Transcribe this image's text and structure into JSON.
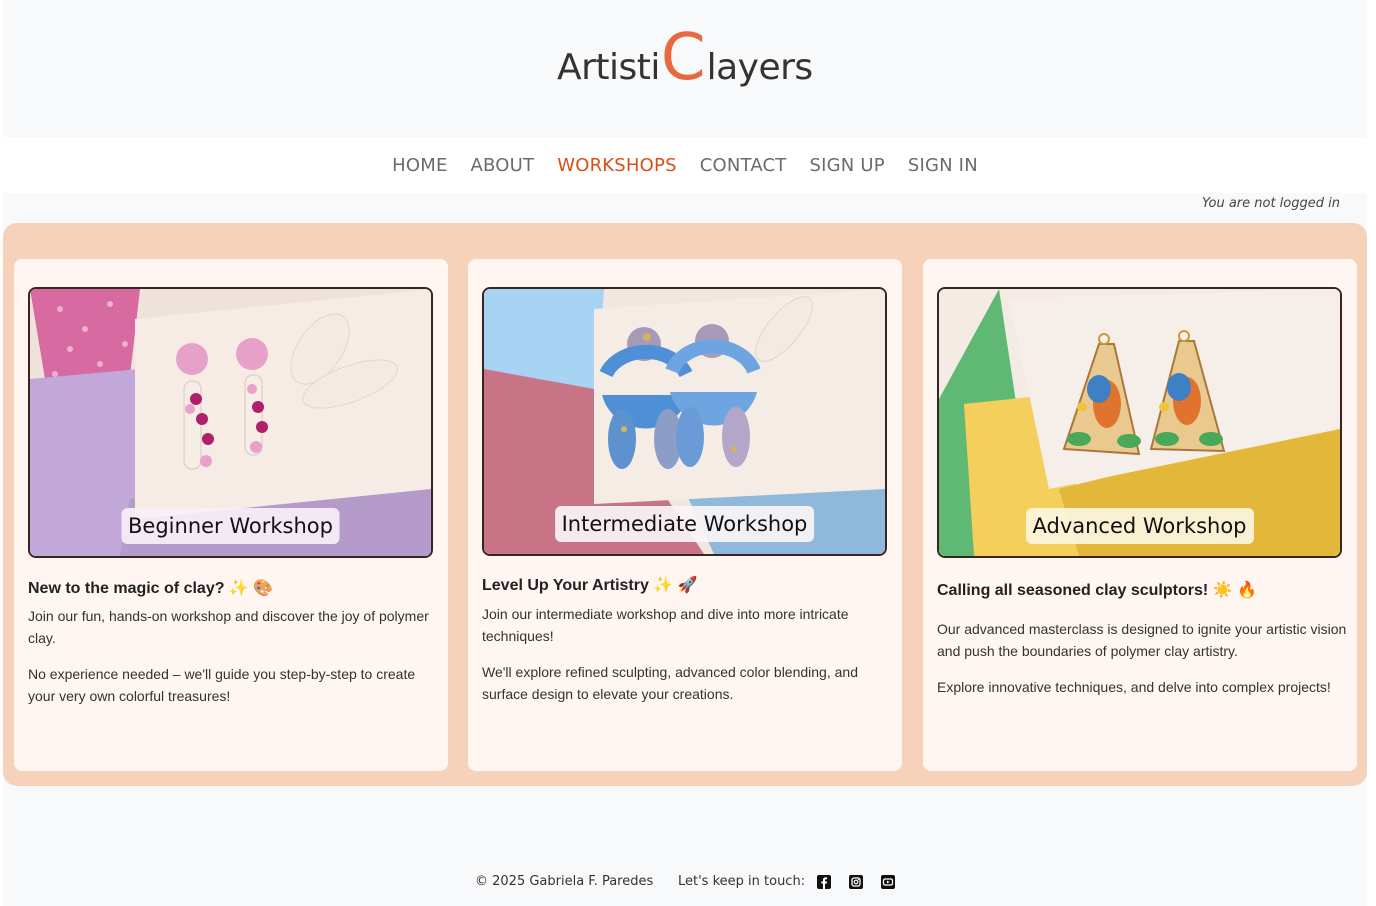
{
  "logo": {
    "part1": "Artisti",
    "accent": "C",
    "part2": "layers",
    "accent_color": "#e8693e"
  },
  "nav": {
    "items": [
      {
        "label": "HOME",
        "active": false
      },
      {
        "label": "ABOUT",
        "active": false
      },
      {
        "label": "WORKSHOPS",
        "active": true
      },
      {
        "label": "CONTACT",
        "active": false
      },
      {
        "label": "SIGN UP",
        "active": false
      },
      {
        "label": "SIGN IN",
        "active": false
      }
    ]
  },
  "login_status": "You are not logged in",
  "workshops": [
    {
      "label": "Beginner Workshop",
      "title": "New to the magic of clay? ✨ 🎨",
      "paragraphs": [
        "Join our fun, hands-on workshop and discover the joy of polymer clay.",
        "No experience needed – we'll guide you step-by-step to create your very own colorful treasures!"
      ]
    },
    {
      "label": "Intermediate Workshop",
      "title": "Level Up Your Artistry ✨ 🚀",
      "paragraphs": [
        "Join our intermediate workshop and dive into more intricate techniques!",
        "We'll explore refined sculpting, advanced color blending, and surface design to elevate your creations."
      ]
    },
    {
      "label": "Advanced Workshop",
      "title": "Calling all seasoned clay sculptors! ☀️ 🔥",
      "paragraphs": [
        "Our advanced masterclass is designed to ignite your artistic vision and push the boundaries of polymer clay artistry.",
        "Explore innovative techniques, and delve into complex projects!"
      ]
    }
  ],
  "footer": {
    "copyright": "© 2025 Gabriela F. Paredes",
    "keep_in_touch": "Let's keep in touch:",
    "social_icons": [
      "facebook-icon",
      "instagram-icon",
      "youtube-icon"
    ]
  },
  "colors": {
    "accent": "#d94f17",
    "panel": "#f5d2b9",
    "card": "#fff5f1"
  }
}
